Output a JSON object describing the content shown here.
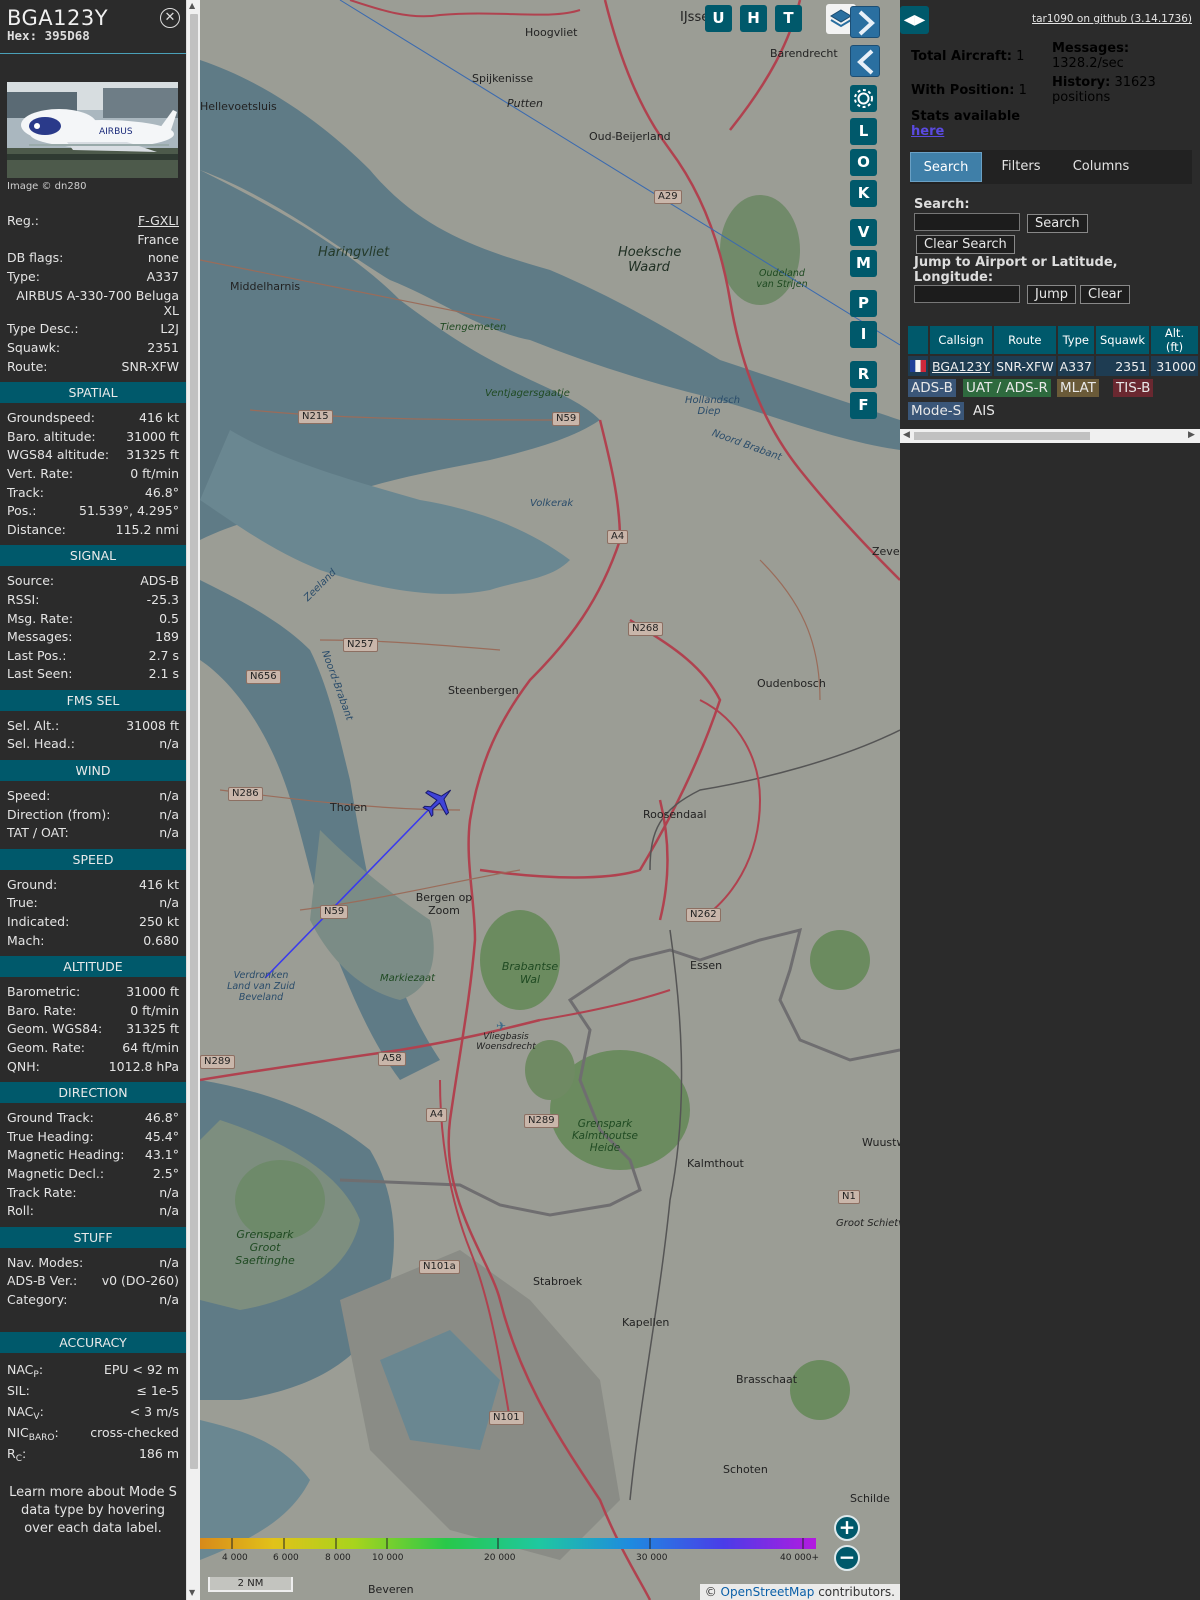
{
  "info": {
    "callsign": "BGA123Y",
    "hex": "Hex: 395D68",
    "photo_credit": "Image © dn280",
    "basic": [
      {
        "label": "Reg.:",
        "value": "F-GXLI"
      },
      {
        "label": "",
        "value": "France"
      },
      {
        "label": "DB flags:",
        "value": "none"
      },
      {
        "label": "Type:",
        "value": "A337"
      },
      {
        "label": "",
        "value": "AIRBUS A-330-700 Beluga XL"
      },
      {
        "label": "Type Desc.:",
        "value": "L2J"
      },
      {
        "label": "Squawk:",
        "value": "2351"
      },
      {
        "label": "Route:",
        "value": "SNR-XFW"
      }
    ],
    "sections": [
      {
        "title": "SPATIAL",
        "rows": [
          {
            "label": "Groundspeed:",
            "value": "416 kt"
          },
          {
            "label": "Baro. altitude:",
            "value": "31000 ft"
          },
          {
            "label": "WGS84 altitude:",
            "value": "31325 ft"
          },
          {
            "label": "Vert. Rate:",
            "value": "0 ft/min"
          },
          {
            "label": "Track:",
            "value": "46.8°"
          },
          {
            "label": "Pos.:",
            "value": "51.539°, 4.295°"
          },
          {
            "label": "Distance:",
            "value": "115.2 nmi"
          }
        ]
      },
      {
        "title": "SIGNAL",
        "rows": [
          {
            "label": "Source:",
            "value": "ADS-B"
          },
          {
            "label": "RSSI:",
            "value": "-25.3"
          },
          {
            "label": "Msg. Rate:",
            "value": "0.5"
          },
          {
            "label": "Messages:",
            "value": "189"
          },
          {
            "label": "Last Pos.:",
            "value": "2.7 s"
          },
          {
            "label": "Last Seen:",
            "value": "2.1 s"
          }
        ]
      },
      {
        "title": "FMS SEL",
        "rows": [
          {
            "label": "Sel. Alt.:",
            "value": "31008 ft"
          },
          {
            "label": "Sel. Head.:",
            "value": "n/a"
          }
        ]
      },
      {
        "title": "WIND",
        "rows": [
          {
            "label": "Speed:",
            "value": "n/a"
          },
          {
            "label": "Direction (from):",
            "value": "n/a"
          },
          {
            "label": "TAT / OAT:",
            "value": "n/a"
          }
        ]
      },
      {
        "title": "SPEED",
        "rows": [
          {
            "label": "Ground:",
            "value": "416 kt"
          },
          {
            "label": "True:",
            "value": "n/a"
          },
          {
            "label": "Indicated:",
            "value": "250 kt"
          },
          {
            "label": "Mach:",
            "value": "0.680"
          }
        ]
      },
      {
        "title": "ALTITUDE",
        "rows": [
          {
            "label": "Barometric:",
            "value": "31000 ft"
          },
          {
            "label": "Baro. Rate:",
            "value": "0 ft/min"
          },
          {
            "label": "Geom. WGS84:",
            "value": "31325 ft"
          },
          {
            "label": "Geom. Rate:",
            "value": "64 ft/min"
          },
          {
            "label": "QNH:",
            "value": "1012.8 hPa"
          }
        ]
      },
      {
        "title": "DIRECTION",
        "rows": [
          {
            "label": "Ground Track:",
            "value": "46.8°"
          },
          {
            "label": "True Heading:",
            "value": "45.4°"
          },
          {
            "label": "Magnetic Heading:",
            "value": "43.1°"
          },
          {
            "label": "Magnetic Decl.:",
            "value": "2.5°"
          },
          {
            "label": "Track Rate:",
            "value": "n/a"
          },
          {
            "label": "Roll:",
            "value": "n/a"
          }
        ]
      },
      {
        "title": "STUFF",
        "rows": [
          {
            "label": "Nav. Modes:",
            "value": "n/a"
          },
          {
            "label": "ADS-B Ver.:",
            "value": "v0 (DO-260)"
          },
          {
            "label": "Category:",
            "value": "n/a"
          }
        ]
      }
    ],
    "accuracy_title": "ACCURACY",
    "accuracy": [
      {
        "label": "NAC",
        "sub": "P",
        "value": "EPU < 92 m"
      },
      {
        "label": "SIL:",
        "sub": "",
        "value": "≤ 1e-5"
      },
      {
        "label": "NAC",
        "sub": "V",
        "value": "< 3 m/s"
      },
      {
        "label": "NIC",
        "sub": "BARO",
        "value": "cross-checked"
      },
      {
        "label": "R",
        "sub": "C",
        "value": "186 m"
      }
    ],
    "note": "Learn more about Mode S data type by hovering over each data label."
  },
  "map": {
    "buttons_top": [
      "U",
      "H",
      "T"
    ],
    "buttons_side": [
      "L",
      "O",
      "K",
      "V",
      "M",
      "P",
      "I",
      "R",
      "F"
    ],
    "settings_icon": "gear-icon",
    "layers_icon": "layers-icon",
    "zoom_in": "+",
    "zoom_out": "−",
    "scale": "2 NM",
    "attribution_prefix": "© ",
    "attribution_link": "OpenStreetMap",
    "attribution_suffix": " contributors.",
    "altitude_labels": [
      "4 000",
      "6 000",
      "8 000",
      "10 000",
      "20 000",
      "30 000",
      "40 000+"
    ],
    "place_labels": [
      "Hoogvliet",
      "Spijkenisse",
      "Putten",
      "Barendrecht",
      "Hellevoetsluis",
      "Oud-Beijerland",
      "Haringvliet",
      "Hoeksche Waard",
      "Middelharnis",
      "Tiengemeten",
      "Ventjagersgaatje",
      "Hollandsch Diep",
      "Noord Brabant",
      "Volkerak",
      "Zeeland",
      "Noord-Brabant",
      "Steenbergen",
      "Oudenbosch",
      "Tholen",
      "Roosendaal",
      "Bergen op Zoom",
      "Brabantse Wal",
      "Essen",
      "Markiezaat",
      "Verdronken Land van Zuid Beveland",
      "Vliegbasis Woensdrecht",
      "Grenspark Kalmthoutse Heide",
      "Kalmthout",
      "Grenspark Groot Saeftinghe",
      "Stabroek",
      "Kapellen",
      "Brasschaat",
      "Schoten",
      "Schilde",
      "Zeven",
      "Wuustw",
      "Groot Schietve",
      "Oudeland van Strijen",
      "IJsse",
      "Beveren"
    ],
    "road_shields": [
      "A29",
      "N215",
      "N59",
      "A4",
      "N257",
      "N268",
      "N656",
      "N286",
      "N59",
      "N262",
      "A58",
      "N289",
      "A4",
      "N289",
      "N1",
      "N101a",
      "N101"
    ]
  },
  "sidebar": {
    "github": "tar1090 on github (3.14.1736)",
    "total_aircraft_label": "Total Aircraft:",
    "total_aircraft": "1",
    "with_position_label": "With Position:",
    "with_position": "1",
    "stats_label": "Stats available",
    "stats_link": "here",
    "messages_label": "Messages:",
    "messages": "1328.2/sec",
    "history_label": "History:",
    "history": "31623 positions",
    "tabs": [
      "Search",
      "Filters",
      "Columns"
    ],
    "search_label": "Search:",
    "search_button": "Search",
    "clear_search_button": "Clear Search",
    "jump_label": "Jump to Airport or Latitude, Longitude:",
    "jump_button": "Jump",
    "clear_button": "Clear",
    "table_headers": [
      "Callsign",
      "Route",
      "Type",
      "Squawk",
      "Alt. (ft)"
    ],
    "table_rows": [
      {
        "callsign": "BGA123Y",
        "route": "SNR-XFW",
        "type": "A337",
        "squawk": "2351",
        "alt": "31000"
      }
    ],
    "legend": [
      "ADS-B",
      "UAT / ADS-R",
      "MLAT",
      "TIS-B",
      "Mode-S",
      "AIS"
    ],
    "legend_colors": [
      "#3a5678",
      "#2e6a3e",
      "#6a5a38",
      "#6a2830",
      "#3a5678",
      "#2b2b2b"
    ]
  }
}
